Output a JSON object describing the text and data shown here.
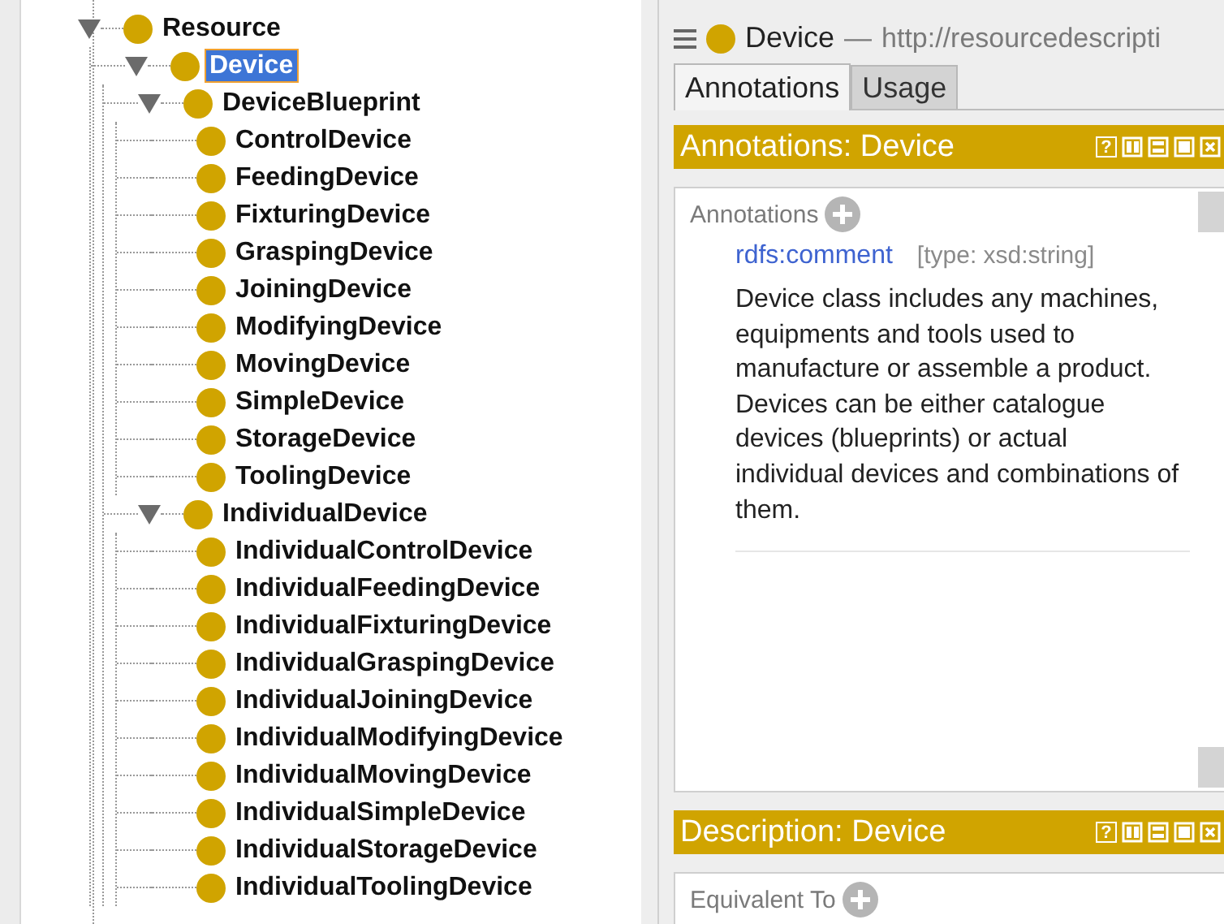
{
  "tree": [
    {
      "label": "Resource",
      "expanded": true,
      "selected": false,
      "children": [
        {
          "label": "Device",
          "expanded": true,
          "selected": true,
          "children": [
            {
              "label": "DeviceBlueprint",
              "expanded": true,
              "selected": false,
              "children": [
                {
                  "label": "ControlDevice",
                  "selected": false
                },
                {
                  "label": "FeedingDevice",
                  "selected": false
                },
                {
                  "label": "FixturingDevice",
                  "selected": false
                },
                {
                  "label": "GraspingDevice",
                  "selected": false
                },
                {
                  "label": "JoiningDevice",
                  "selected": false
                },
                {
                  "label": "ModifyingDevice",
                  "selected": false
                },
                {
                  "label": "MovingDevice",
                  "selected": false
                },
                {
                  "label": "SimpleDevice",
                  "selected": false
                },
                {
                  "label": "StorageDevice",
                  "selected": false
                },
                {
                  "label": "ToolingDevice",
                  "selected": false
                }
              ]
            },
            {
              "label": "IndividualDevice",
              "expanded": true,
              "selected": false,
              "children": [
                {
                  "label": "IndividualControlDevice",
                  "selected": false
                },
                {
                  "label": "IndividualFeedingDevice",
                  "selected": false
                },
                {
                  "label": "IndividualFixturingDevice",
                  "selected": false
                },
                {
                  "label": "IndividualGraspingDevice",
                  "selected": false
                },
                {
                  "label": "IndividualJoiningDevice",
                  "selected": false
                },
                {
                  "label": "IndividualModifyingDevice",
                  "selected": false
                },
                {
                  "label": "IndividualMovingDevice",
                  "selected": false
                },
                {
                  "label": "IndividualSimpleDevice",
                  "selected": false
                },
                {
                  "label": "IndividualStorageDevice",
                  "selected": false
                },
                {
                  "label": "IndividualToolingDevice",
                  "selected": false
                }
              ]
            }
          ]
        }
      ]
    }
  ],
  "entity": {
    "name": "Device",
    "separator": "—",
    "iri": "http://resourcedescripti"
  },
  "tabs": [
    {
      "label": "Annotations",
      "selected": true
    },
    {
      "label": "Usage",
      "selected": false
    }
  ],
  "views": [
    {
      "title": "Annotations: Device",
      "help": "?",
      "section": "Annotations",
      "annotations": [
        {
          "property": "rdfs:comment",
          "datatype": "[type: xsd:string]",
          "value": "Device class includes any machines, equipments and tools used to manufacture or assemble a product. Devices can be either catalogue devices (blueprints) or actual individual devices and combinations of them."
        }
      ]
    },
    {
      "title": "Description: Device",
      "help": "?",
      "section": "Equivalent To"
    }
  ]
}
